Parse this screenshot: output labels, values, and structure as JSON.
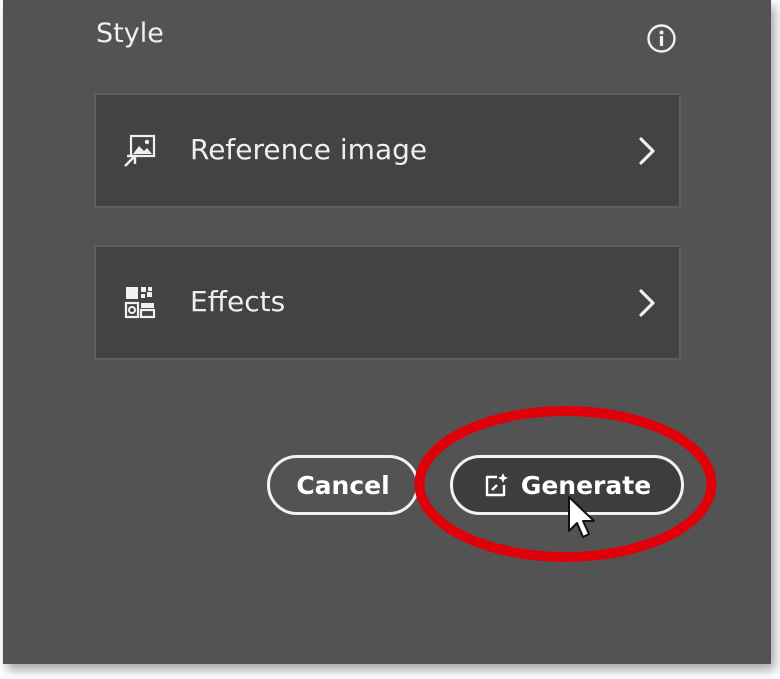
{
  "panel": {
    "section_title": "Style",
    "info_icon": "info-circle-icon"
  },
  "rows": [
    {
      "label": "Reference image",
      "icon": "reference-image-icon",
      "chevron": "chevron-right-icon"
    },
    {
      "label": "Effects",
      "icon": "effects-icon",
      "chevron": "chevron-right-icon"
    }
  ],
  "buttons": {
    "cancel_label": "Cancel",
    "generate_label": "Generate",
    "generate_icon": "generate-sparkle-icon"
  },
  "colors": {
    "panel_bg": "#535353",
    "card_bg": "#434343",
    "highlight": "#e0000a",
    "text": "#eeeeee"
  }
}
